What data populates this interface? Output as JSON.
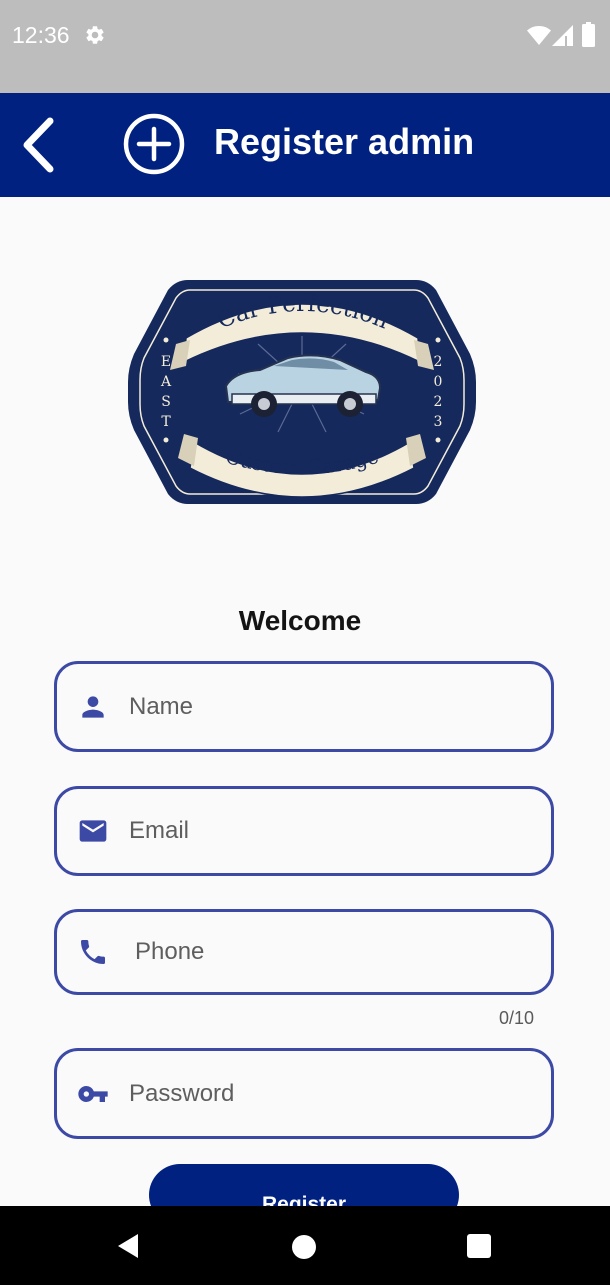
{
  "status_bar": {
    "time": "12:36",
    "icons": [
      "gear-icon",
      "wifi-icon",
      "signal-icon",
      "battery-icon"
    ]
  },
  "app_bar": {
    "title": "Register admin",
    "back_icon": "chevron-left-icon",
    "action_icon": "add-circle-icon",
    "color": "#012180"
  },
  "logo": {
    "top_text": "Car Perfection",
    "bottom_text": "Custom Garage",
    "left_text": "EAST",
    "right_text": "2023",
    "color": "#15295c"
  },
  "form": {
    "welcome": "Welcome",
    "fields": {
      "name": {
        "placeholder": "Name",
        "value": "",
        "icon": "person-icon"
      },
      "email": {
        "placeholder": "Email",
        "value": "",
        "icon": "mail-icon"
      },
      "phone": {
        "placeholder": "Phone",
        "value": "",
        "icon": "phone-icon",
        "counter": "0/10"
      },
      "password": {
        "placeholder": "Password",
        "value": "",
        "icon": "key-icon"
      }
    },
    "submit_label": "Register",
    "border_color": "#3d4aa5",
    "icon_color": "#3d4aa5"
  },
  "nav_bar": {
    "buttons": [
      "back-triangle-icon",
      "home-circle-icon",
      "recents-square-icon"
    ]
  }
}
